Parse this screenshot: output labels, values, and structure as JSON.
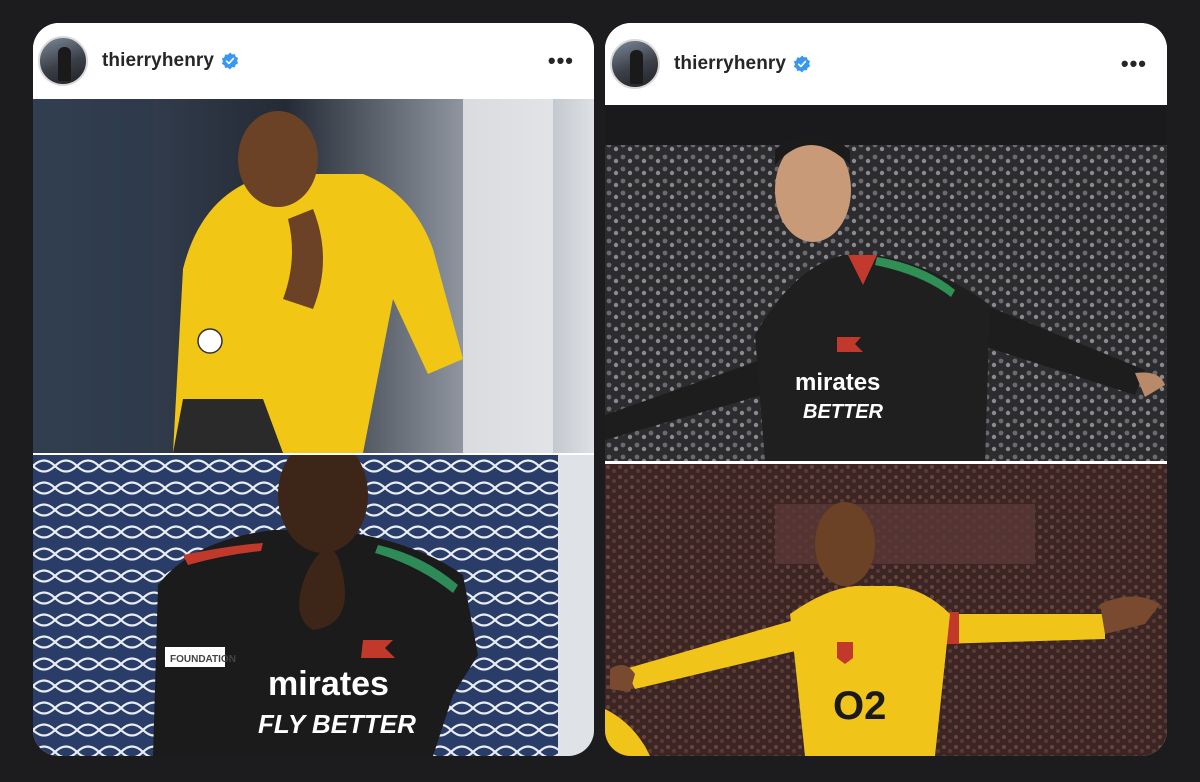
{
  "posts": [
    {
      "username": "thierryhenry",
      "verified": true,
      "more_icon": "more-horizontal-icon",
      "photos": [
        {
          "subject": "player in yellow kit, finger to lips"
        },
        {
          "subject": "player in black kit, finger to lips",
          "shirt_text": [
            "mirates",
            "FLY BETTER"
          ],
          "sleeve_badge": "FOUNDATION"
        }
      ]
    },
    {
      "username": "thierryhenry",
      "verified": true,
      "more_icon": "more-horizontal-icon",
      "photos": [
        {
          "subject": "player in black kit celebrating, arms out",
          "shirt_text": [
            "mirates",
            "BETTER"
          ]
        },
        {
          "subject": "player in yellow kit celebrating, arms out",
          "shirt_text": [
            "O2"
          ]
        }
      ]
    }
  ],
  "colors": {
    "background": "#1c1c1e",
    "card": "#ffffff",
    "verified_blue": "#3897f0",
    "username": "#262626"
  }
}
